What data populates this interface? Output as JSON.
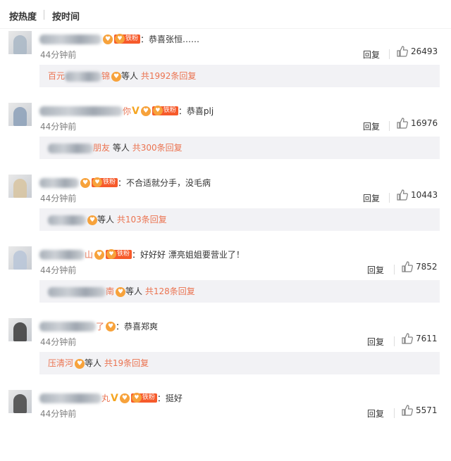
{
  "sort_tabs": [
    "按热度",
    "按时间"
  ],
  "comments": [
    {
      "author_visible": "",
      "badges": [
        "badge-icon",
        "fan-badge"
      ],
      "text": "：恭喜张恒……",
      "time": "44分钟前",
      "reply_label": "回复",
      "likes": "26493",
      "reply_box": {
        "replier": "百元",
        "replier_suffix": "锦",
        "suffix_text": "等人",
        "count_text": "共1992条回复"
      },
      "avatar_color": "#a9b7c6"
    },
    {
      "author_visible": "你",
      "badges": [
        "vip-icon",
        "badge-icon",
        "fan-badge"
      ],
      "text": "：恭喜plj",
      "time": "44分钟前",
      "reply_label": "回复",
      "likes": "16976",
      "reply_box": {
        "replier": "",
        "replier_suffix": "朋友",
        "suffix_text": "等人",
        "count_text": "共300条回复"
      },
      "avatar_color": "#8ca0b8"
    },
    {
      "author_visible": "",
      "badges": [
        "badge-icon",
        "fan-badge"
      ],
      "text": "：不合适就分手，没毛病",
      "time": "44分钟前",
      "reply_label": "回复",
      "likes": "10443",
      "reply_box": {
        "replier": "",
        "replier_suffix": "",
        "suffix_text": "等人",
        "count_text": "共103条回复"
      },
      "avatar_color": "#d8c4a0"
    },
    {
      "author_visible": "山",
      "badges": [
        "badge-icon",
        "fan-badge"
      ],
      "text": "：好好好 漂亮姐姐要营业了！",
      "time": "44分钟前",
      "reply_label": "回复",
      "likes": "7852",
      "reply_box": {
        "replier": "",
        "replier_suffix": "南",
        "suffix_text": "等人",
        "count_text": "共128条回复"
      },
      "avatar_color": "#b8c6d8"
    },
    {
      "author_visible": "了",
      "badges": [
        "badge-icon"
      ],
      "text": "：恭喜郑爽",
      "time": "44分钟前",
      "reply_label": "回复",
      "likes": "7611",
      "reply_box": {
        "replier": "压清河",
        "replier_suffix": "",
        "suffix_text": "等人",
        "count_text": "共19条回复"
      },
      "avatar_color": "#3a3a3a"
    },
    {
      "author_visible": "丸",
      "badges": [
        "vip-icon",
        "badge-icon",
        "fan-badge"
      ],
      "text": "：挺好",
      "time": "44分钟前",
      "reply_label": "回复",
      "likes": "5571",
      "reply_box": null,
      "avatar_color": "#444444"
    }
  ],
  "badge_labels": {
    "fan_badge_text": "铁粉",
    "vip_glyph": "V"
  },
  "colors": {
    "accent": "#eb7350",
    "badge_orange": "#f7a23b",
    "fan_red": "#f65a2b",
    "reply_bg": "#f2f2f5",
    "muted": "#808080"
  }
}
